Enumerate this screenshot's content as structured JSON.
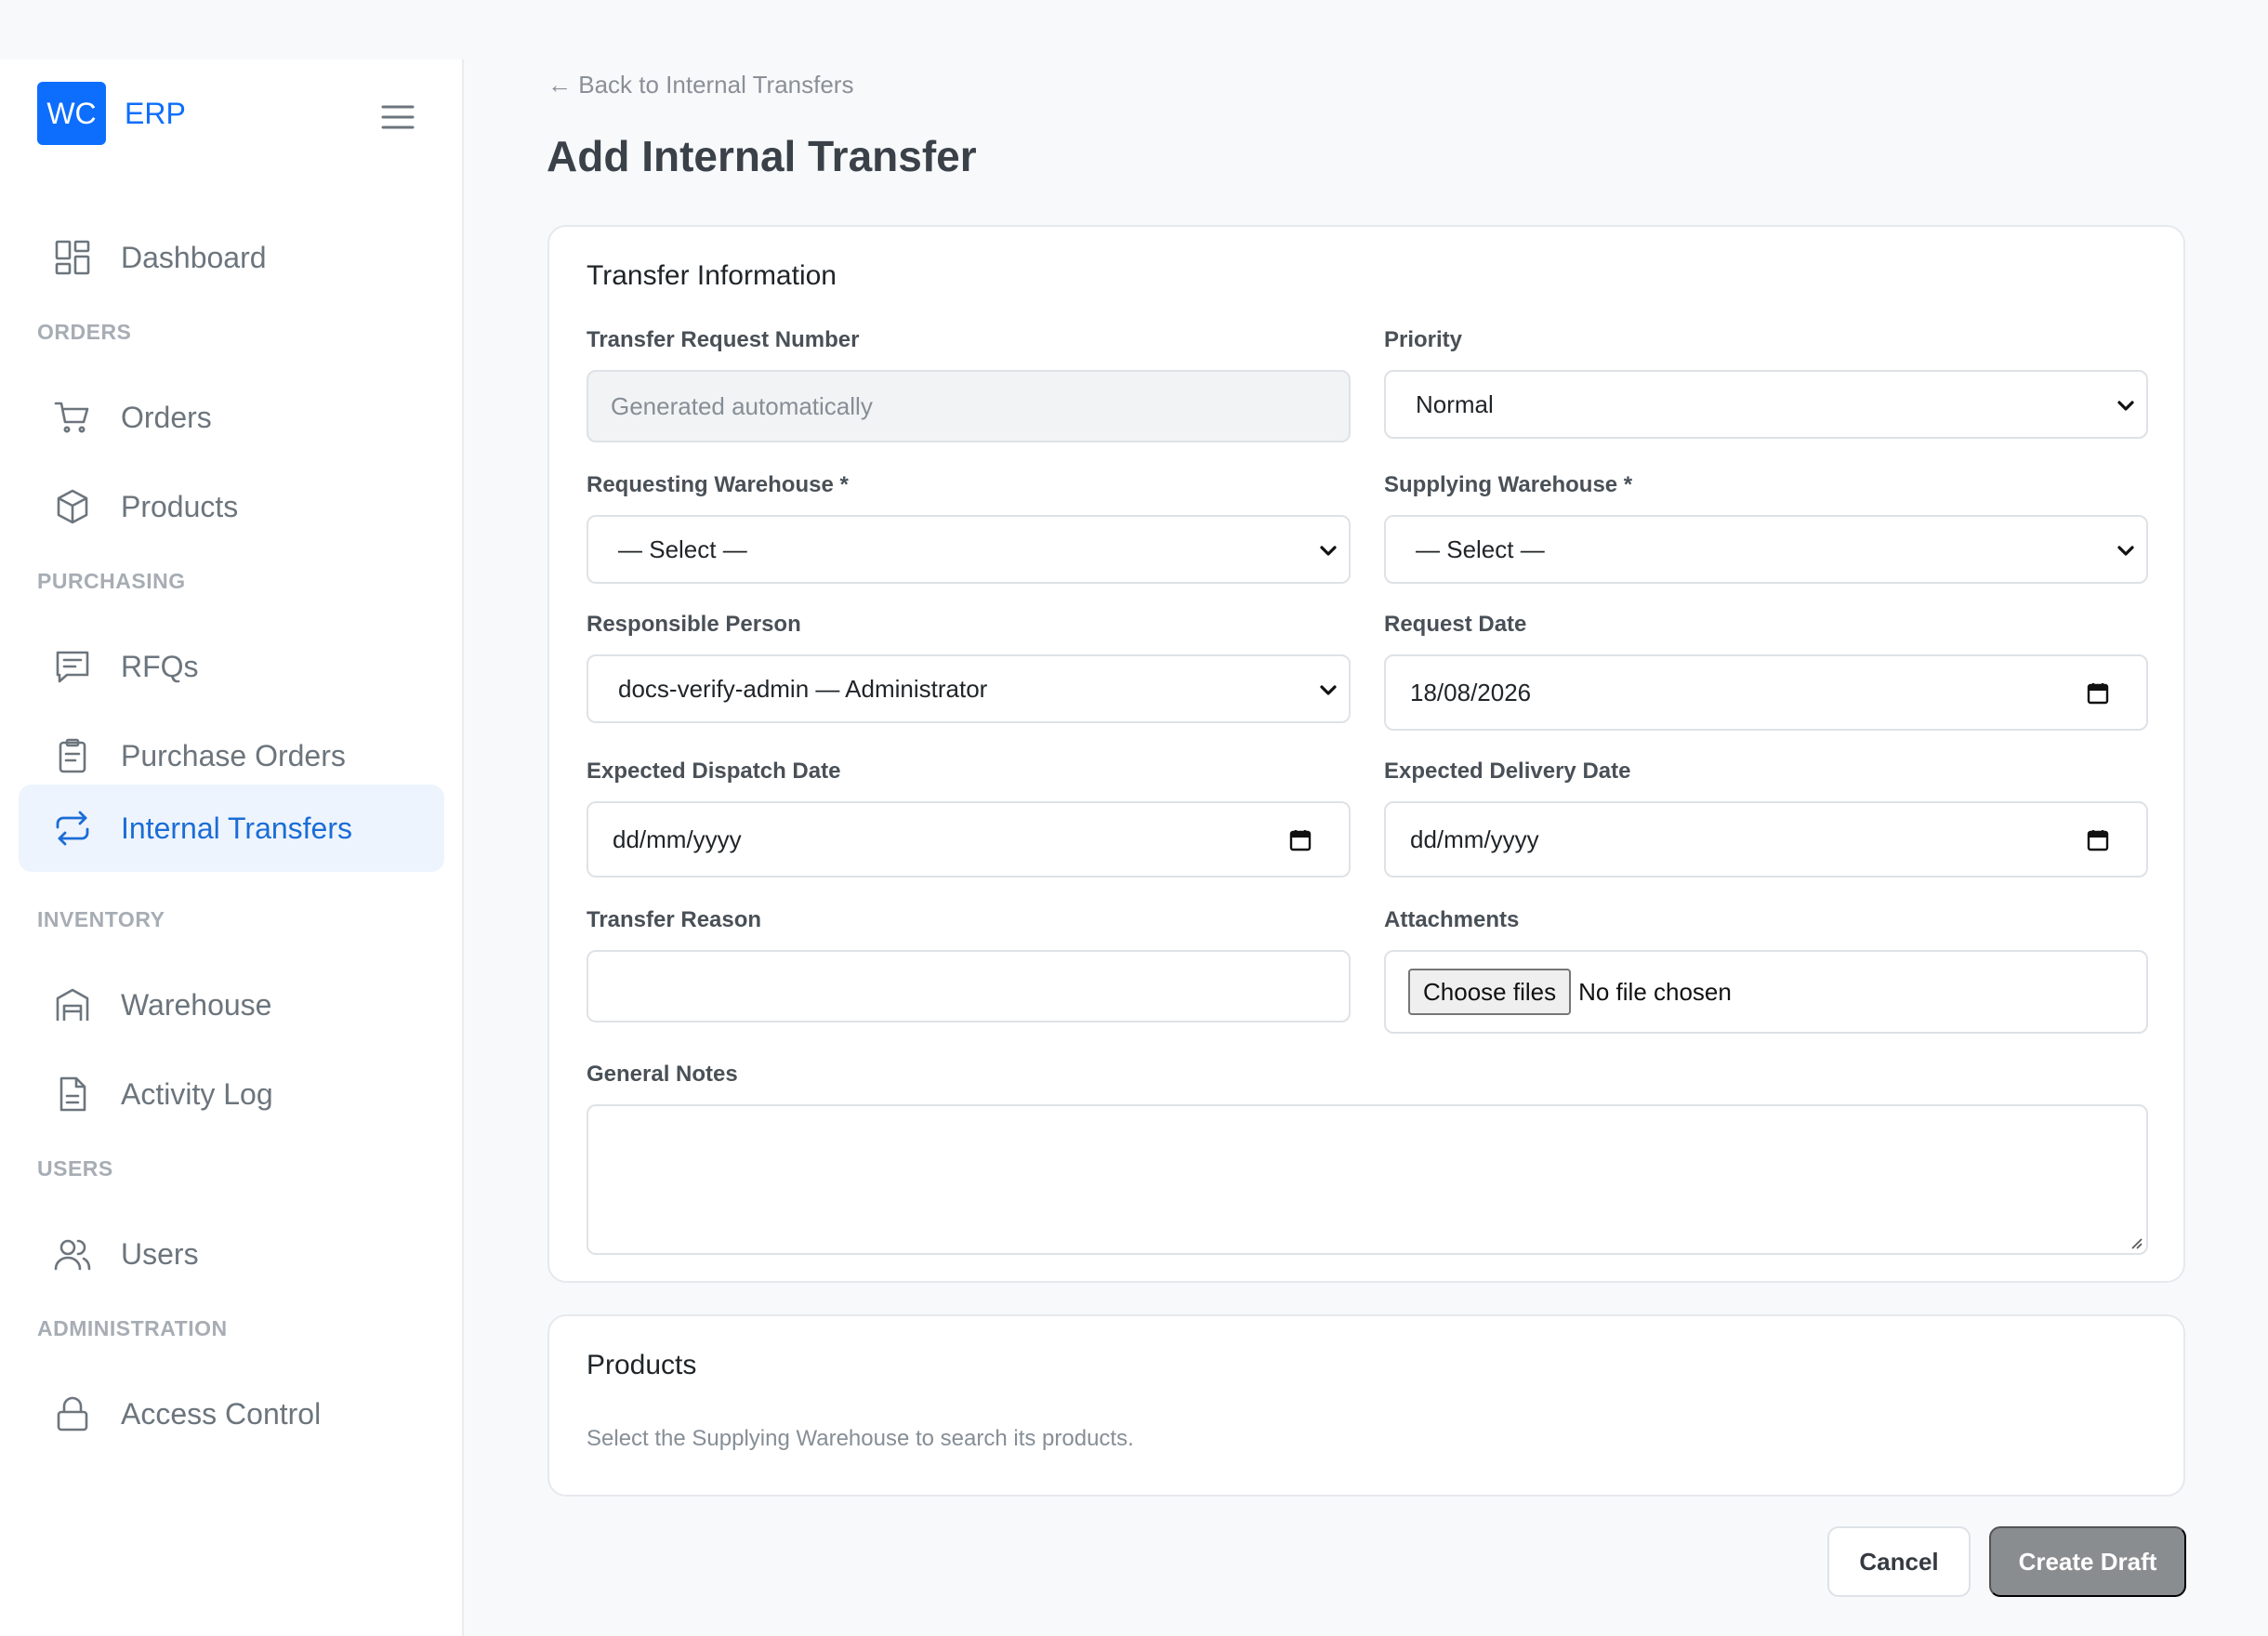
{
  "brand": {
    "logo": "WC",
    "name": "ERP"
  },
  "sidebar": {
    "items": [
      {
        "label": "Dashboard",
        "icon": "dashboard-icon"
      },
      {
        "section": "ORDERS"
      },
      {
        "label": "Orders",
        "icon": "cart-icon"
      },
      {
        "label": "Products",
        "icon": "box-icon"
      },
      {
        "section": "PURCHASING"
      },
      {
        "label": "RFQs",
        "icon": "message-icon"
      },
      {
        "label": "Purchase Orders",
        "icon": "clipboard-icon"
      },
      {
        "label": "Internal Transfers",
        "icon": "transfer-icon",
        "active": true
      },
      {
        "section": "INVENTORY"
      },
      {
        "label": "Warehouse",
        "icon": "warehouse-icon"
      },
      {
        "label": "Activity Log",
        "icon": "document-icon"
      },
      {
        "section": "USERS"
      },
      {
        "label": "Users",
        "icon": "users-icon"
      },
      {
        "section": "ADMINISTRATION"
      },
      {
        "label": "Access Control",
        "icon": "lock-icon"
      }
    ]
  },
  "header": {
    "back_link": "← Back to Internal Transfers",
    "title": "Add Internal Transfer"
  },
  "transfer_info": {
    "title": "Transfer Information",
    "request_number": {
      "label": "Transfer Request Number",
      "placeholder": "Generated automatically"
    },
    "priority": {
      "label": "Priority",
      "value": "Normal"
    },
    "requesting_warehouse": {
      "label": "Requesting Warehouse *",
      "value": "— Select —"
    },
    "supplying_warehouse": {
      "label": "Supplying Warehouse *",
      "value": "— Select —"
    },
    "responsible_person": {
      "label": "Responsible Person",
      "value": "docs-verify-admin — Administrator"
    },
    "request_date": {
      "label": "Request Date",
      "value": "18/08/2026"
    },
    "expected_dispatch_date": {
      "label": "Expected Dispatch Date",
      "value": "dd/mm/yyyy"
    },
    "expected_delivery_date": {
      "label": "Expected Delivery Date",
      "value": "dd/mm/yyyy"
    },
    "transfer_reason": {
      "label": "Transfer Reason",
      "value": ""
    },
    "attachments": {
      "label": "Attachments",
      "button": "Choose files",
      "status": "No file chosen"
    },
    "general_notes": {
      "label": "General Notes",
      "value": ""
    }
  },
  "products": {
    "title": "Products",
    "helper": "Select the Supplying Warehouse to search its products."
  },
  "actions": {
    "cancel": "Cancel",
    "create": "Create Draft"
  },
  "colors": {
    "accent": "#0d6efd",
    "active_bg": "#eef4fd",
    "disabled_button": "#8a8d90"
  }
}
